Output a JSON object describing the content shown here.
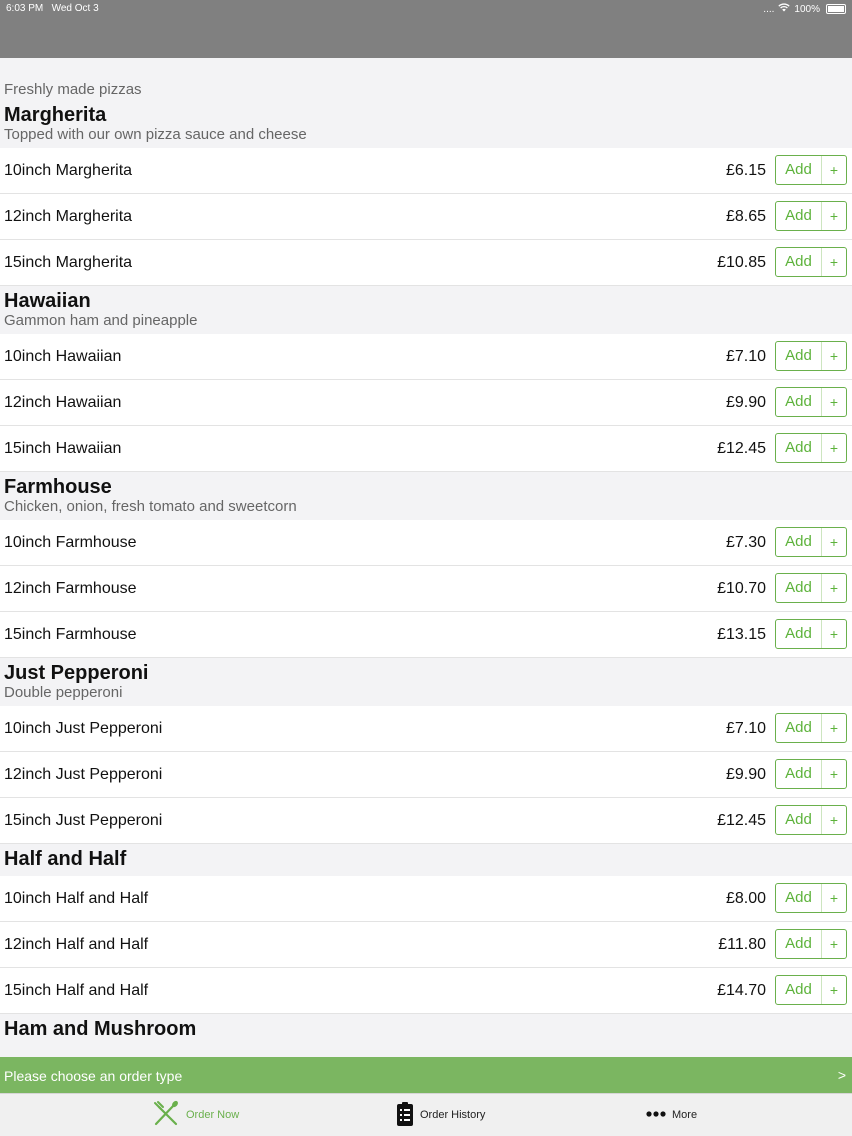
{
  "status": {
    "time": "6:03 PM",
    "date": "Wed Oct 3",
    "signal": "....",
    "battery": "100%"
  },
  "menu": {
    "intro": "Freshly made pizzas",
    "groups": [
      {
        "title": "Margherita",
        "desc": "Topped with our own pizza sauce and cheese",
        "items": [
          {
            "name": "10inch Margherita",
            "price": "£6.15"
          },
          {
            "name": "12inch Margherita",
            "price": "£8.65"
          },
          {
            "name": "15inch Margherita",
            "price": "£10.85"
          }
        ]
      },
      {
        "title": "Hawaiian",
        "desc": "Gammon ham and pineapple",
        "items": [
          {
            "name": "10inch Hawaiian",
            "price": "£7.10"
          },
          {
            "name": "12inch Hawaiian",
            "price": "£9.90"
          },
          {
            "name": "15inch Hawaiian",
            "price": "£12.45"
          }
        ]
      },
      {
        "title": "Farmhouse",
        "desc": "Chicken, onion, fresh tomato and sweetcorn",
        "items": [
          {
            "name": "10inch Farmhouse",
            "price": "£7.30"
          },
          {
            "name": "12inch Farmhouse",
            "price": "£10.70"
          },
          {
            "name": "15inch Farmhouse",
            "price": "£13.15"
          }
        ]
      },
      {
        "title": "Just Pepperoni",
        "desc": "Double pepperoni",
        "items": [
          {
            "name": "10inch Just Pepperoni",
            "price": "£7.10"
          },
          {
            "name": "12inch Just Pepperoni",
            "price": "£9.90"
          },
          {
            "name": "15inch Just Pepperoni",
            "price": "£12.45"
          }
        ]
      },
      {
        "title": "Half and Half",
        "desc": "",
        "items": [
          {
            "name": "10inch Half and Half",
            "price": "£8.00"
          },
          {
            "name": "12inch Half and Half",
            "price": "£11.80"
          },
          {
            "name": "15inch Half and Half",
            "price": "£14.70"
          }
        ]
      },
      {
        "title": "Ham and Mushroom",
        "desc": "",
        "items": []
      }
    ],
    "add_label": "Add",
    "add_plus": "+"
  },
  "order_type": {
    "label": "Please choose an order type",
    "chevron": ">"
  },
  "tabs": {
    "order_now": "Order Now",
    "order_history": "Order History",
    "more": "More"
  },
  "colors": {
    "accent": "#6ab04c",
    "order_bar": "#7bb661",
    "status_bar": "#808080"
  }
}
